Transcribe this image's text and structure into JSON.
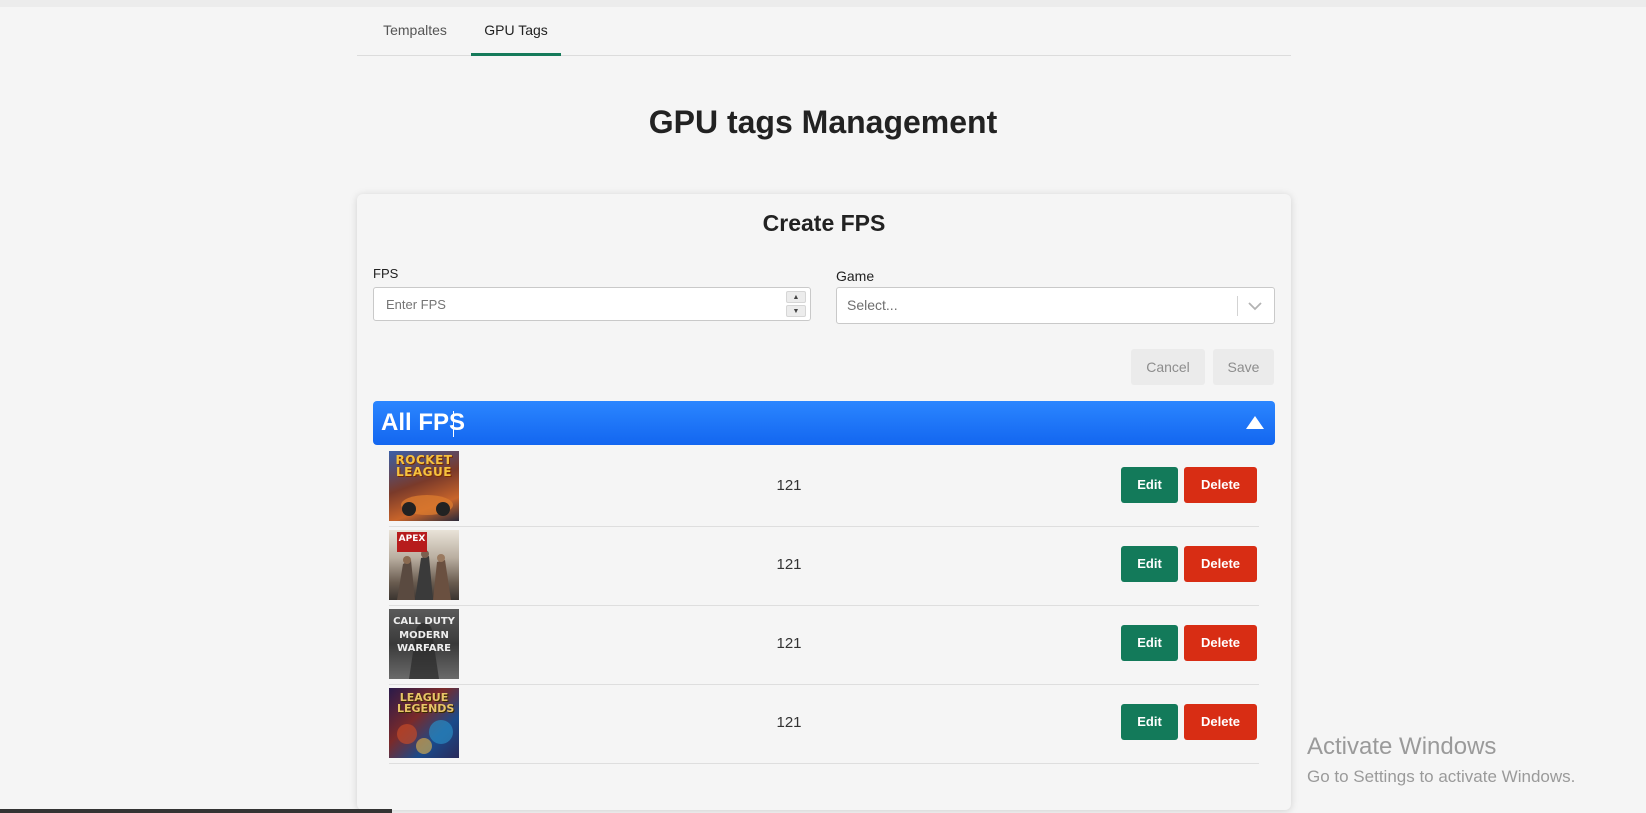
{
  "tabs": [
    {
      "label": "Tempaltes"
    },
    {
      "label": "GPU Tags"
    }
  ],
  "page_title": "GPU tags Management",
  "form": {
    "title": "Create FPS",
    "fps_label": "FPS",
    "fps_placeholder": "Enter FPS",
    "game_label": "Game",
    "game_placeholder": "Select...",
    "cancel_label": "Cancel",
    "save_label": "Save"
  },
  "list": {
    "title": "All FPS",
    "header_color": "#1a73f5",
    "items": [
      {
        "game_art": "ROCKET LEAGUE",
        "fps": "121",
        "edit_label": "Edit",
        "delete_label": "Delete"
      },
      {
        "game_art": "APEX",
        "fps": "121",
        "edit_label": "Edit",
        "delete_label": "Delete"
      },
      {
        "game_art": "CALL DUTY MODERN WARFARE",
        "fps": "121",
        "edit_label": "Edit",
        "delete_label": "Delete"
      },
      {
        "game_art": "LEAGUE LEGENDS",
        "fps": "121",
        "edit_label": "Edit",
        "delete_label": "Delete"
      }
    ]
  },
  "watermark": {
    "line1": "Activate Windows",
    "line2": "Go to Settings to activate Windows."
  },
  "colors": {
    "accent_green": "#137a5a",
    "danger_red": "#d82d14",
    "primary_blue": "#1a73f5"
  }
}
